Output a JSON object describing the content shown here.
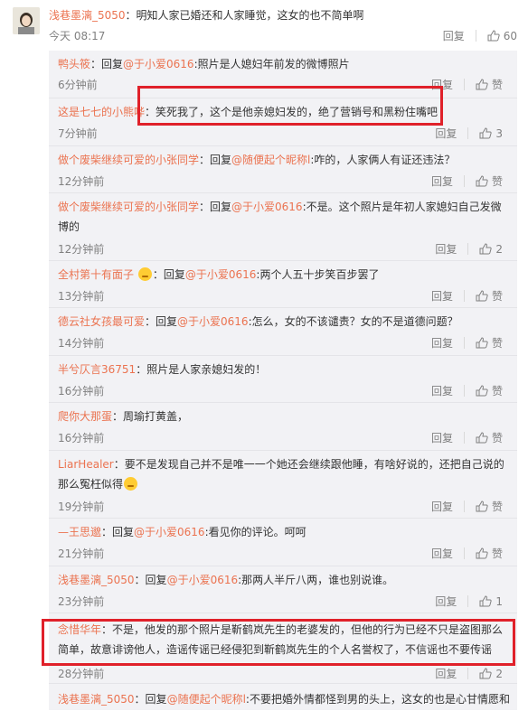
{
  "top_comment": {
    "user": "浅巷墨漓_5050",
    "text": "：明知人家已婚还和人家睡觉，这女的也不简单啊",
    "time": "今天 08:17",
    "reply": "回复",
    "likes": "60"
  },
  "replies": [
    {
      "user": "鸭头筱",
      "text": "：回复",
      "mention": "@于小爱0616",
      "rest": ":照片是人媳妇年前发的微博照片",
      "time": "6分钟前",
      "reply": "回复",
      "likes": "赞"
    },
    {
      "user": "这是七七的小熊哗",
      "text": "：笑死我了，这个是他亲媳妇发的，绝了营销号和黑粉住嘴吧",
      "mention": "",
      "rest": "",
      "time": "7分钟前",
      "reply": "回复",
      "likes": "3"
    },
    {
      "user": "做个废柴继续可爱的小张同学",
      "text": "：回复",
      "mention": "@随便起个昵称l",
      "rest": ":咋的，人家俩人有证还违法？",
      "time": "12分钟前",
      "reply": "回复",
      "likes": "赞"
    },
    {
      "user": "做个废柴继续可爱的小张同学",
      "text": "：回复",
      "mention": "@于小爱0616",
      "rest": ":不是。这个照片是年初人家媳妇自己发微博的",
      "time": "12分钟前",
      "reply": "回复",
      "likes": "2"
    },
    {
      "user": "全村第十有面子",
      "text": "：回复",
      "mention": "@于小爱0616",
      "rest": ":两个人五十步笑百步罢了",
      "time": "13分钟前",
      "reply": "回复",
      "likes": "赞"
    },
    {
      "user": "德云社女孩最可爱",
      "text": "：回复",
      "mention": "@于小爱0616",
      "rest": ":怎么，女的不该谴责？女的不是道德问题？",
      "time": "14分钟前",
      "reply": "回复",
      "likes": "赞"
    },
    {
      "user": "半兮仄言36751",
      "text": "：照片是人家亲媳妇发的！",
      "mention": "",
      "rest": "",
      "time": "16分钟前",
      "reply": "回复",
      "likes": "赞"
    },
    {
      "user": "爬你大那蛋",
      "text": "：周瑜打黄盖，",
      "mention": "",
      "rest": "",
      "time": "16分钟前",
      "reply": "回复",
      "likes": "赞"
    },
    {
      "user": "LiarHealer",
      "text": "：要不是发现自己并不是唯一一个她还会继续跟他睡，有啥好说的，还把自己说的那么冤枉似得",
      "mention": "",
      "rest": "",
      "time": "19分钟前",
      "reply": "回复",
      "likes": "赞"
    },
    {
      "user": "—王思邈",
      "text": "：回复",
      "mention": "@于小爱0616",
      "rest": ":看见你的评论。呵呵",
      "time": "21分钟前",
      "reply": "回复",
      "likes": "赞"
    },
    {
      "user": "浅巷墨漓_5050",
      "text": "：回复",
      "mention": "@于小爱0616",
      "rest": ":那两人半斤八两，谁也别说谁。",
      "time": "23分钟前",
      "reply": "回复",
      "likes": "1"
    },
    {
      "user": "念惜华年",
      "text": "：不是，他发的那个照片是靳鹤岚先生的老婆发的，但他的行为已经不只是盗图那么简单，故意诽谤他人，造谣传谣已经侵犯到靳鹤岚先生的个人名誉权了，不信谣也不要传谣",
      "mention": "",
      "rest": "",
      "time": "28分钟前",
      "reply": "回复",
      "likes": "2"
    },
    {
      "user": "浅巷墨漓_5050",
      "text": "：回复",
      "mention": "@随便起个昵称l",
      "rest": ":不要把婚外情都怪到男的头上，这女的也是心甘情愿和",
      "time": "",
      "reply": "",
      "likes": ""
    }
  ],
  "colors": {
    "username": "#eb7350",
    "highlight": "#e0212a",
    "panel": "#f2f2f5"
  },
  "icons": {
    "like": "thumbs-up-icon"
  }
}
